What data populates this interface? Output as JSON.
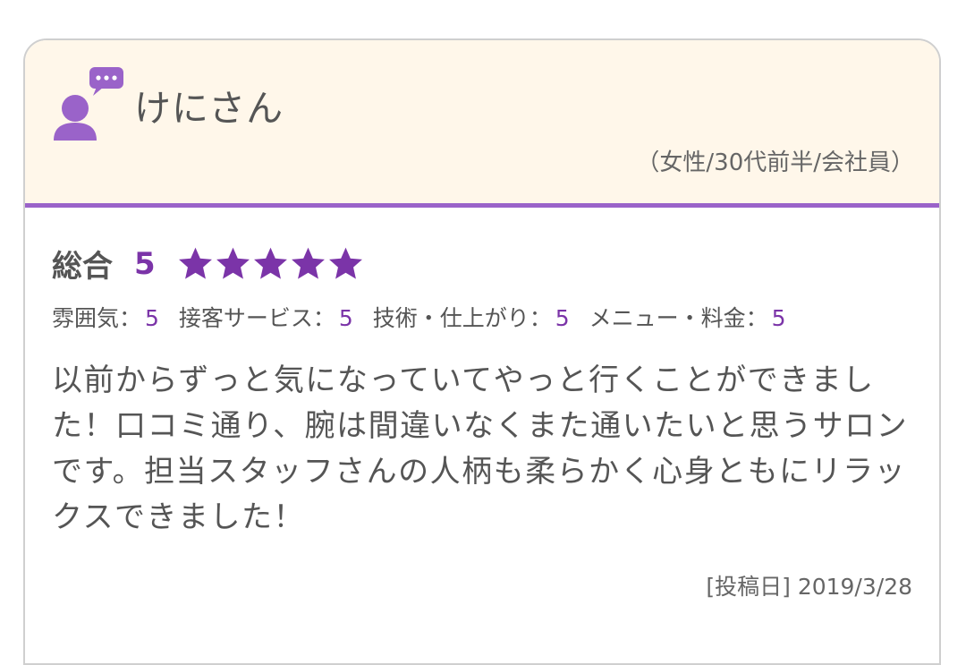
{
  "reviewer": {
    "name": "けにさん",
    "profile": "（女性/30代前半/会社員）",
    "avatar_icon": "user-comment-icon"
  },
  "rating": {
    "overall_label": "総合",
    "overall_score": "5",
    "stars": 5,
    "star_color": "#7b34a8",
    "sub_ratings": [
      {
        "label": "雰囲気：",
        "value": "5"
      },
      {
        "label": "接客サービス：",
        "value": "5"
      },
      {
        "label": "技術・仕上がり：",
        "value": "5"
      },
      {
        "label": "メニュー・料金：",
        "value": "5"
      }
    ]
  },
  "review": {
    "text": "以前からずっと気になっていてやっと行くことができました！口コミ通り、腕は間違いなくまた通いたいと思うサロンです。担当スタッフさんの人柄も柔らかく心身ともにリラックスできました！",
    "date_label": "[投稿日] 2019/3/28"
  },
  "colors": {
    "accent": "#9a63c9",
    "header_bg": "#fff7ea",
    "score": "#7b34a8"
  }
}
